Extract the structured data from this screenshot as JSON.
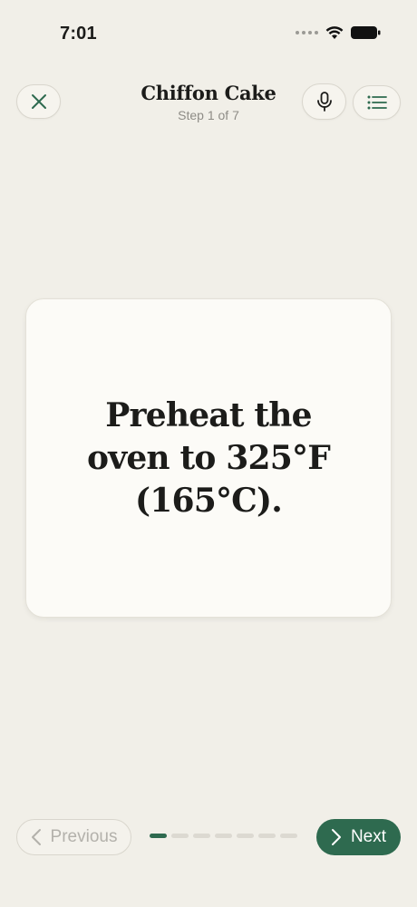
{
  "status_bar": {
    "time": "7:01",
    "icons": [
      "signal-dots",
      "wifi-icon",
      "battery-icon"
    ]
  },
  "header": {
    "title": "Chiffon Cake",
    "subtitle": "Step 1 of 7",
    "close_icon": "close-icon",
    "mic_icon": "microphone-icon",
    "list_icon": "list-icon"
  },
  "step": {
    "text": "Preheat the oven to 325°F (165°C).",
    "current": 1,
    "total": 7
  },
  "footer": {
    "previous_label": "Previous",
    "next_label": "Next",
    "previous_enabled": false
  },
  "colors": {
    "accent": "#2e6a4f",
    "background": "#f1efe8",
    "card": "#fcfbf7"
  }
}
